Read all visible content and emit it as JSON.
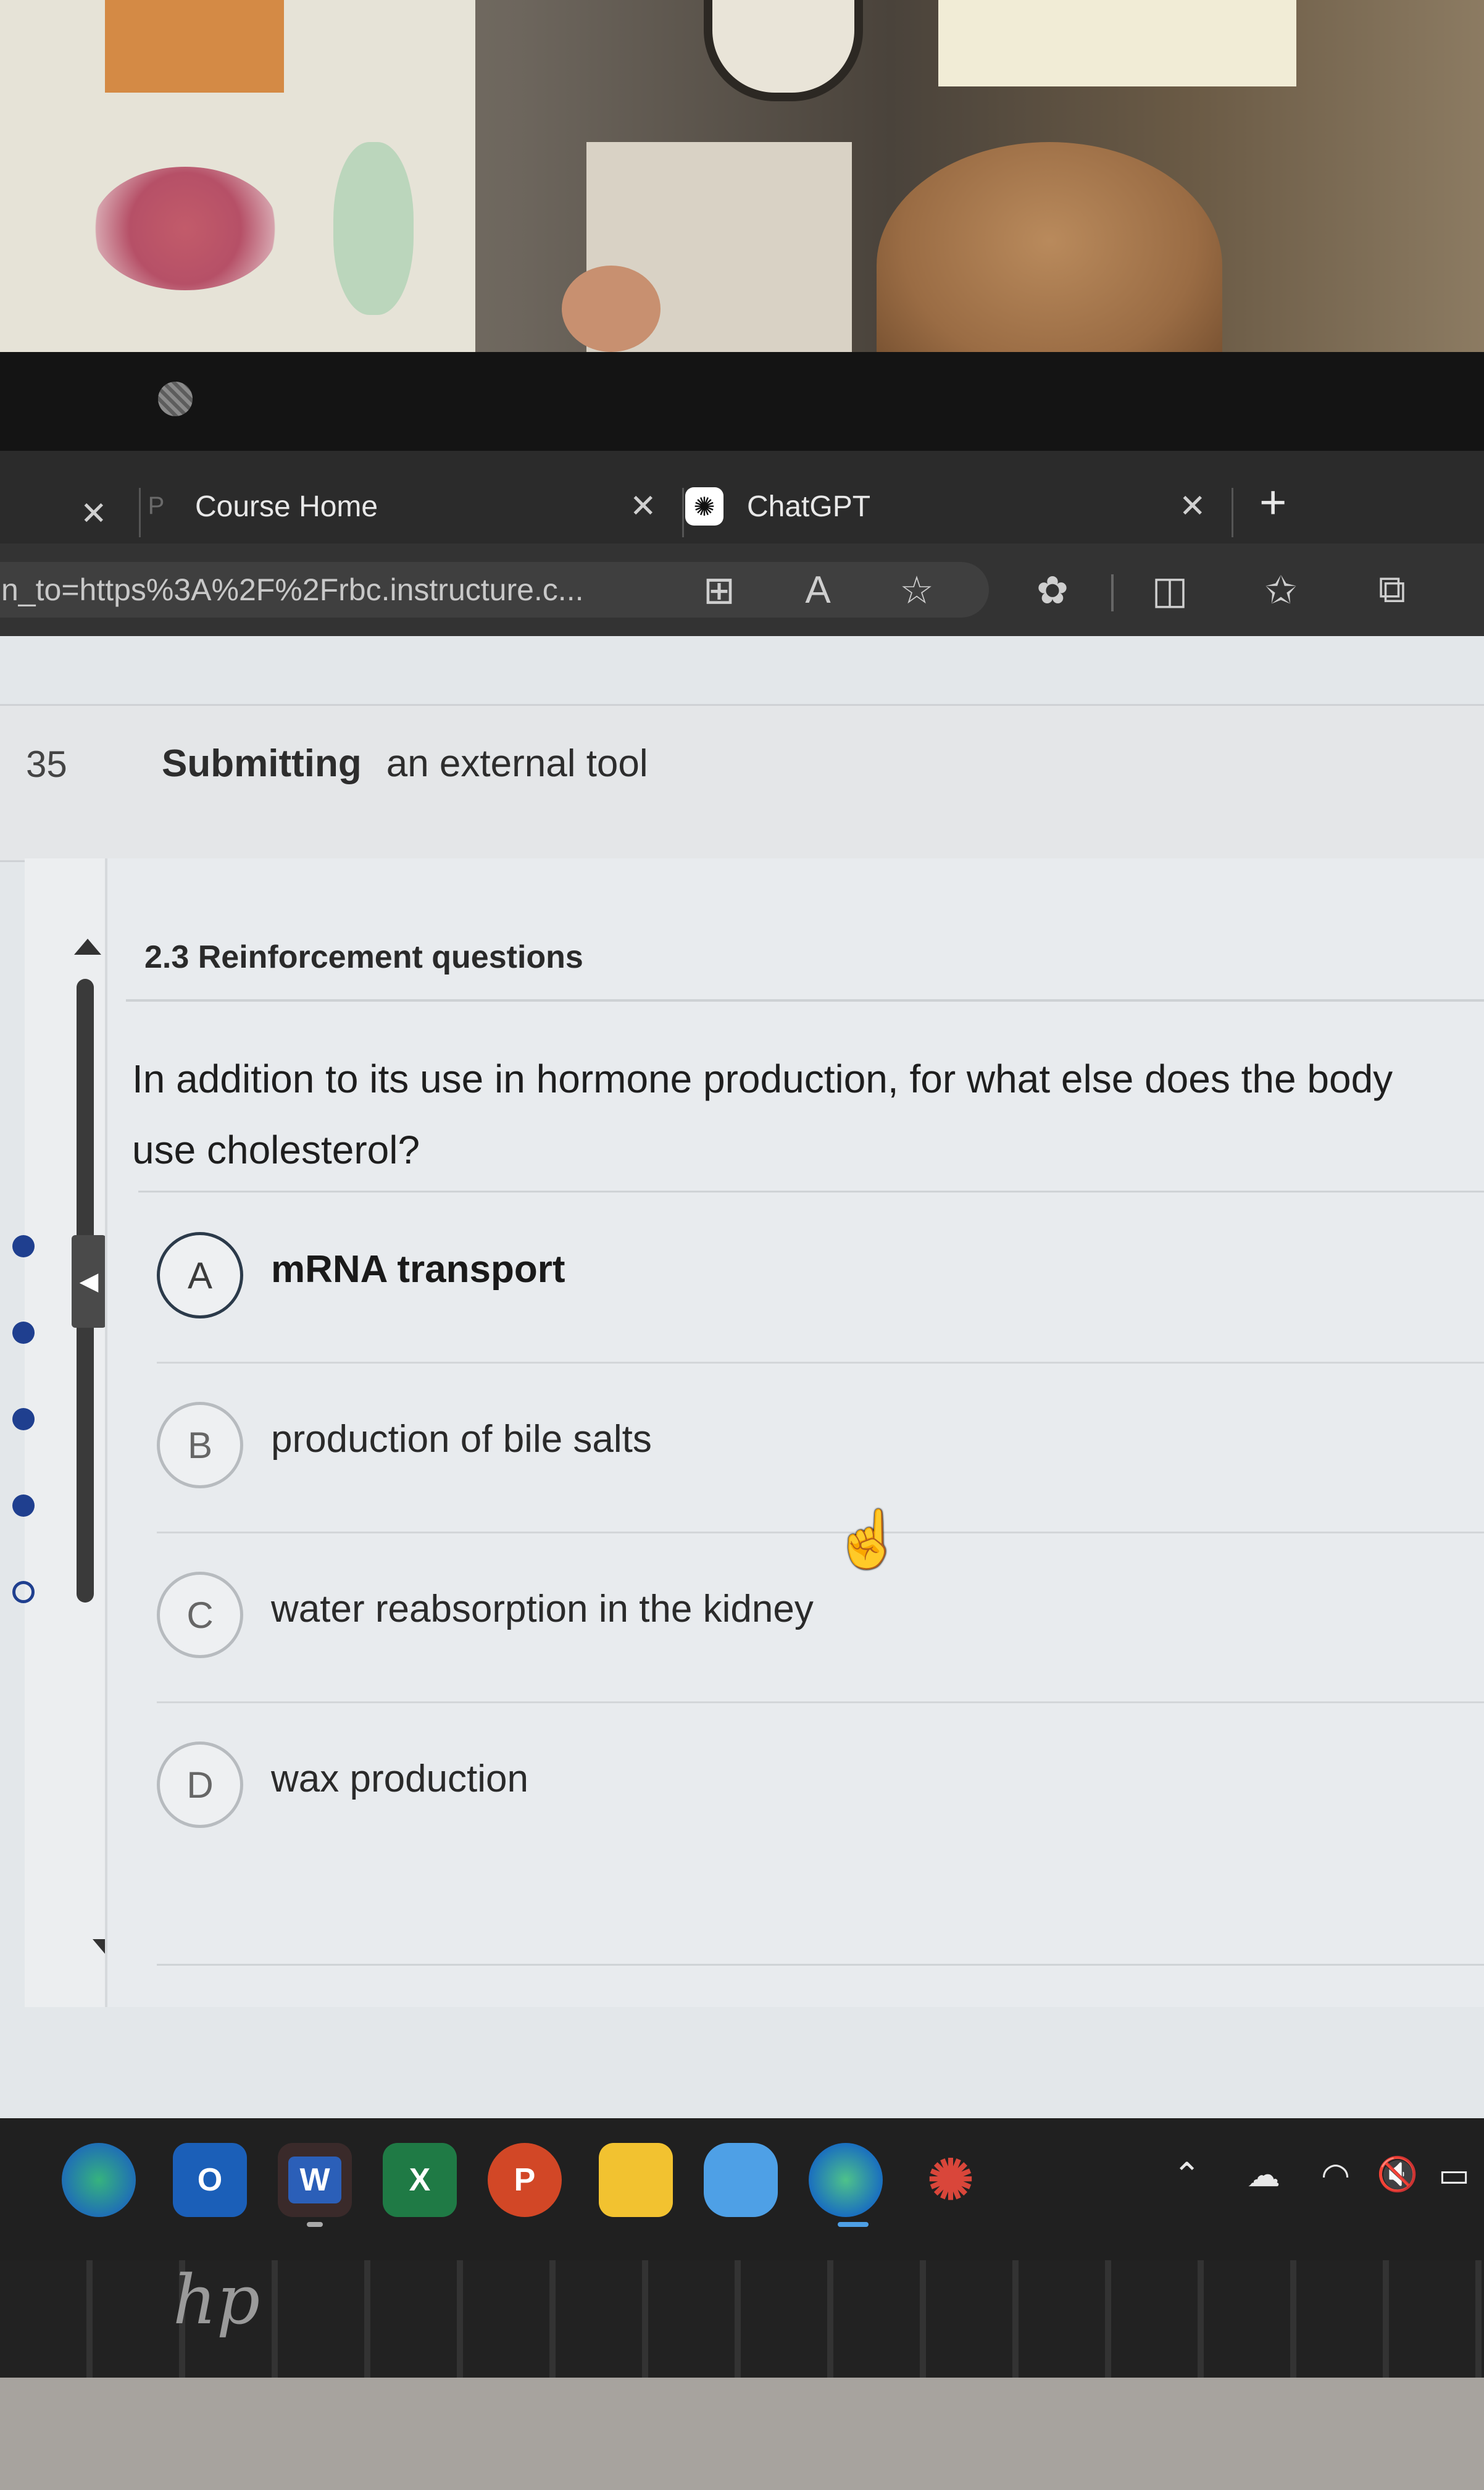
{
  "browser": {
    "tabs": [
      {
        "title": "Course Home",
        "favicon": "canvas-p-icon"
      },
      {
        "title": "ChatGPT",
        "favicon": "chatgpt-icon"
      }
    ],
    "address": "n_to=https%3A%2F%2Frbc.instructure.c...",
    "toolbar_icons": [
      "app-grid-icon",
      "read-aloud-icon",
      "favorite-star-icon",
      "extensions-icon",
      "split-screen-icon",
      "favorites-list-icon",
      "collections-icon"
    ]
  },
  "page": {
    "number": "35",
    "title_bold": "Submitting",
    "title_rest": "an external tool",
    "section_title": "2.3 Reinforcement questions",
    "question": "In addition to its use in hormone production, for what else does the body use cholesterol?",
    "options": [
      {
        "letter": "A",
        "text": "mRNA transport",
        "selected": true
      },
      {
        "letter": "B",
        "text": "production of bile salts",
        "selected": false
      },
      {
        "letter": "C",
        "text": "water reabsorption in the kidney",
        "selected": false
      },
      {
        "letter": "D",
        "text": "wax production",
        "selected": false
      }
    ]
  },
  "taskbar": {
    "apps": [
      {
        "name": "edge-profile-icon",
        "glyph": ""
      },
      {
        "name": "outlook-icon",
        "glyph": "O"
      },
      {
        "name": "word-icon",
        "glyph": "W"
      },
      {
        "name": "excel-icon",
        "glyph": "X"
      },
      {
        "name": "powerpoint-icon",
        "glyph": "P"
      },
      {
        "name": "file-explorer-icon",
        "glyph": ""
      },
      {
        "name": "onedrive-icon",
        "glyph": ""
      },
      {
        "name": "edge-work-icon",
        "glyph": ""
      },
      {
        "name": "snipping-icon",
        "glyph": ""
      }
    ],
    "tray": [
      "chevron-up-icon",
      "cloud-icon",
      "wifi-icon",
      "speaker-muted-icon",
      "battery-icon"
    ]
  },
  "colors": {
    "selected_border": "#2b3a4a",
    "word": "#2b5fb8",
    "excel": "#1f7a45",
    "powerpoint": "#d24726",
    "folder": "#f2c230",
    "onedrive": "#4ea0e6"
  }
}
